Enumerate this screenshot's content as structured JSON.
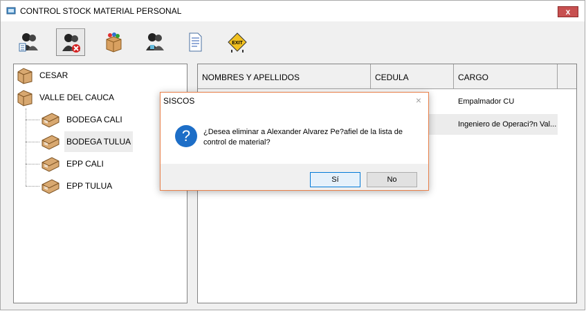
{
  "window": {
    "title": "CONTROL STOCK MATERIAL PERSONAL",
    "close_label": "x"
  },
  "toolbar": {
    "buttons": [
      {
        "name": "users-list",
        "icon": "people-list-icon"
      },
      {
        "name": "delete-user",
        "icon": "people-delete-icon"
      },
      {
        "name": "materials",
        "icon": "box-icon"
      },
      {
        "name": "people",
        "icon": "people-icon"
      },
      {
        "name": "document",
        "icon": "document-icon"
      },
      {
        "name": "exit",
        "icon": "exit-sign-icon",
        "label": "EXIT"
      }
    ]
  },
  "tree": {
    "items": [
      {
        "label": "CESAR",
        "level": 0
      },
      {
        "label": "VALLE DEL CAUCA",
        "level": 0
      },
      {
        "label": "BODEGA CALI",
        "level": 1
      },
      {
        "label": "BODEGA TULUA",
        "level": 1,
        "selected": true
      },
      {
        "label": "EPP CALI",
        "level": 1
      },
      {
        "label": "EPP TULUA",
        "level": 1
      }
    ]
  },
  "table": {
    "columns": [
      "NOMBRES Y APELLIDOS",
      "CEDULA",
      "CARGO"
    ],
    "rows": [
      {
        "cargo": "Empalmador CU"
      },
      {
        "cargo": "Ingeniero de Operaci?n Val...",
        "selected": true
      }
    ]
  },
  "dialog": {
    "title": "SISCOS",
    "close_label": "×",
    "icon": "question-icon",
    "icon_glyph": "?",
    "message_line1": "¿Desea eliminar a Alexander Alvarez Pe?afiel de la lista de",
    "message_line2": "control de material?",
    "yes_label": "Sí",
    "no_label": "No"
  },
  "colors": {
    "dialog_border": "#e8804a",
    "question_icon": "#1d6ec7",
    "close_button": "#c75050"
  }
}
